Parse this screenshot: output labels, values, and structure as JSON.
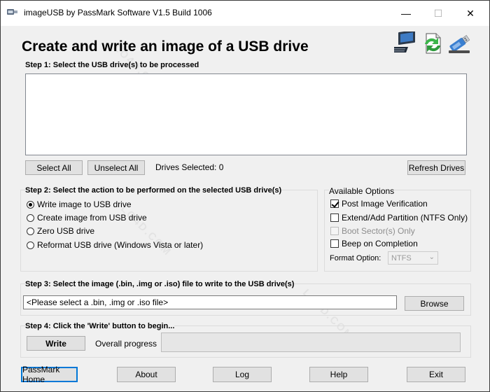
{
  "window": {
    "title": "imageUSB by PassMark Software V1.5 Build 1006",
    "controls": {
      "minimize": "—",
      "maximize": "☐",
      "close": "✕"
    }
  },
  "heading": "Create and write an image of a USB drive",
  "header_icons": [
    "computer-icon",
    "refresh-arrows-icon",
    "usb-drive-icon"
  ],
  "step1": {
    "label": "Step 1:  Select the USB drive(s) to be processed",
    "drives": [],
    "select_all": "Select All",
    "unselect_all": "Unselect All",
    "drives_selected": "Drives Selected: 0",
    "refresh": "Refresh Drives"
  },
  "step2": {
    "label": "Step 2: Select the action to be performed on the selected USB drive(s)",
    "actions": [
      {
        "label": "Write image to USB drive",
        "selected": true
      },
      {
        "label": "Create image from USB drive",
        "selected": false
      },
      {
        "label": "Zero USB drive",
        "selected": false
      },
      {
        "label": "Reformat USB drive (Windows Vista or later)",
        "selected": false
      }
    ]
  },
  "options": {
    "label": "Available Options",
    "items": [
      {
        "label": "Post Image Verification",
        "checked": true,
        "enabled": true
      },
      {
        "label": "Extend/Add Partition (NTFS Only)",
        "checked": false,
        "enabled": true
      },
      {
        "label": "Boot Sector(s) Only",
        "checked": false,
        "enabled": false
      },
      {
        "label": "Beep on Completion",
        "checked": false,
        "enabled": true
      }
    ],
    "format_label": "Format Option:",
    "format_value": "NTFS"
  },
  "step3": {
    "label": "Step 3: Select the image (.bin, .img or .iso) file to write to the USB drive(s)",
    "file_value": "<Please select a .bin, .img or .iso file>",
    "browse": "Browse"
  },
  "step4": {
    "label": "Step 4: Click the 'Write' button to begin...",
    "write": "Write",
    "progress_label": "Overall progress",
    "progress": 0
  },
  "footer": {
    "passmark_home": "PassMark Home",
    "about": "About",
    "log": "Log",
    "help": "Help",
    "exit": "Exit"
  },
  "watermark": "LO4D.COM",
  "colors": {
    "accent": "#0078d7",
    "progress": "#06b025",
    "button_face": "#e1e1e1"
  }
}
